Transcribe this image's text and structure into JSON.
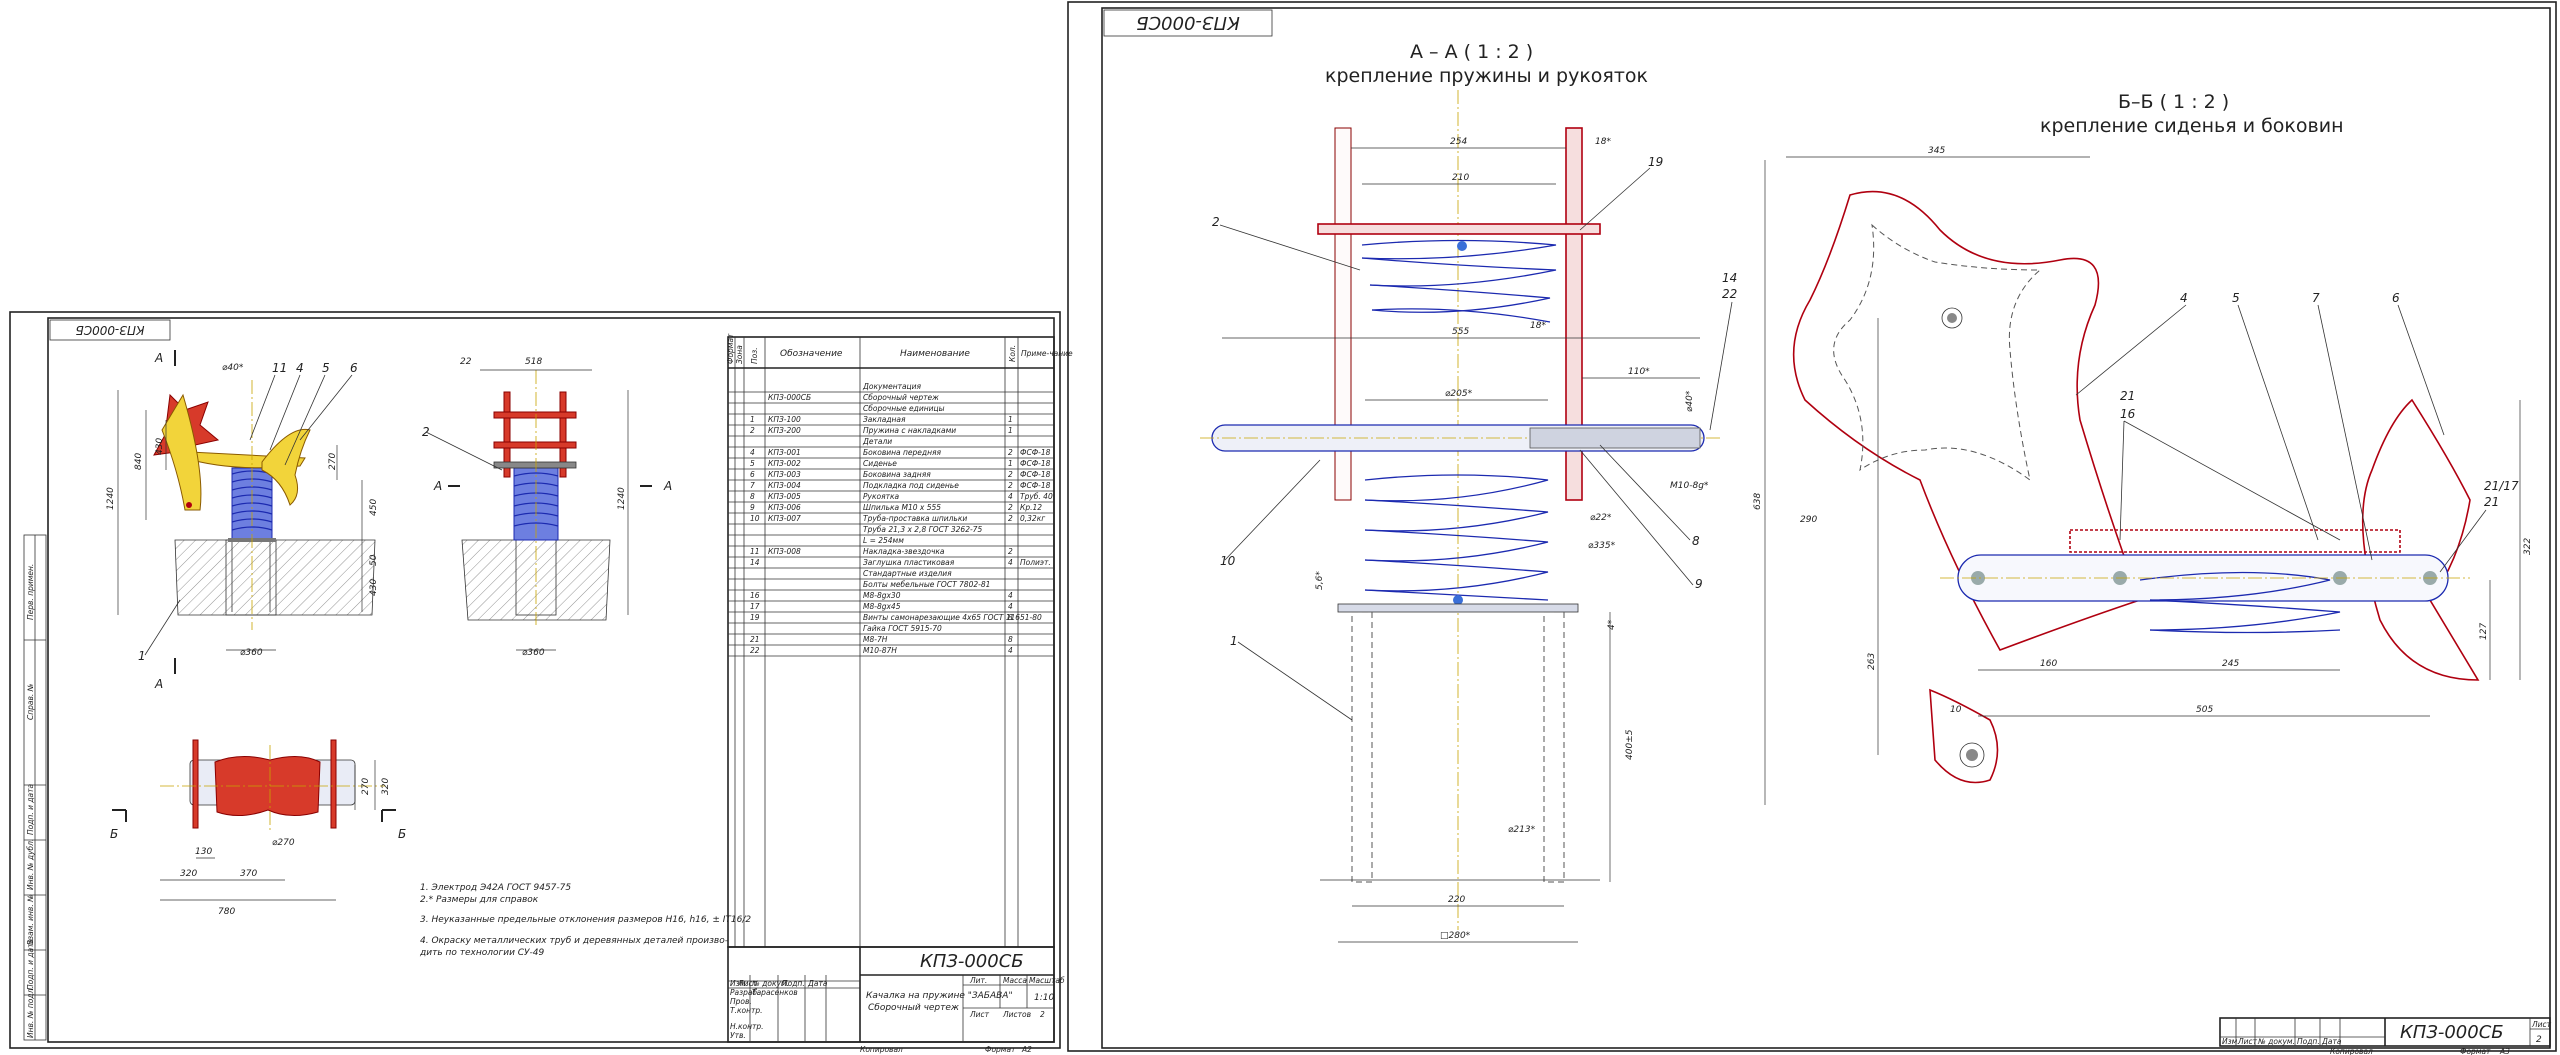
{
  "sheet1": {
    "stamp_rotated": "КПЗ-000СБ",
    "drawing_number": "КПЗ-000СБ",
    "product_name": "Качалка на пружине \"ЗАБАВА\"",
    "doc_type": "Сборочный чертеж",
    "scale": "1:10",
    "sheet_label": "Лист",
    "sheets_label": "Листов",
    "sheets_count": "2",
    "mass_label": "Масса",
    "scale_label": "Масштаб",
    "lit_label": "Лит.",
    "copied_label": "Копировал",
    "format_label": "Формат",
    "format_value": "А2",
    "section_a": "А",
    "section_b": "Б",
    "leaders": [
      "1",
      "2",
      "4",
      "5",
      "6",
      "11"
    ],
    "dims": [
      "⌀40*",
      "840",
      "430",
      "1240",
      "270",
      "450",
      "50",
      "430",
      "⌀360",
      "22",
      "518",
      "1240",
      "⌀360",
      "270",
      "320",
      "⌀270",
      "130",
      "320",
      "370",
      "780"
    ],
    "notes": [
      "1. Электрод Э42А ГОСТ 9457-75",
      "2.* Размеры для справок",
      "3. Неуказанные предельные отклонения размеров H16, h16, ± IT16/2",
      "4. Окраску металлических труб и деревянных деталей произво-",
      "дить по технологии СУ-49"
    ],
    "side_stamps": [
      "Перв. примен.",
      "Справ. №",
      "Подп. и дата",
      "Инв. № дубл.",
      "Взам. инв. №",
      "Подп. и дата",
      "Инв. № подл."
    ],
    "title_block_roles": [
      "Изм.",
      "Лист",
      "№ докум.",
      "Подп.",
      "Дата",
      "Разраб.",
      "Пров.",
      "Т.контр.",
      "Н.контр.",
      "Утв."
    ],
    "developer": "Тарасенков",
    "spec": {
      "headers": [
        "Формат",
        "Зона",
        "Поз.",
        "Обозначение",
        "Наименование",
        "Кол.",
        "Приме-чание"
      ],
      "rows": [
        {
          "pos": "",
          "code": "",
          "name": "Документация",
          "qty": "",
          "note": ""
        },
        {
          "pos": "",
          "code": "КПЗ-000СБ",
          "name": "Сборочный чертеж",
          "qty": "",
          "note": ""
        },
        {
          "pos": "",
          "code": "",
          "name": "Сборочные единицы",
          "qty": "",
          "note": ""
        },
        {
          "pos": "1",
          "code": "КПЗ-100",
          "name": "Закладная",
          "qty": "1",
          "note": ""
        },
        {
          "pos": "2",
          "code": "КПЗ-200",
          "name": "Пружина с накладками",
          "qty": "1",
          "note": ""
        },
        {
          "pos": "",
          "code": "",
          "name": "Детали",
          "qty": "",
          "note": ""
        },
        {
          "pos": "4",
          "code": "КПЗ-001",
          "name": "Боковина передняя",
          "qty": "2",
          "note": "ФСФ-18"
        },
        {
          "pos": "5",
          "code": "КПЗ-002",
          "name": "Сиденье",
          "qty": "1",
          "note": "ФСФ-18"
        },
        {
          "pos": "6",
          "code": "КПЗ-003",
          "name": "Боковина задняя",
          "qty": "2",
          "note": "ФСФ-18"
        },
        {
          "pos": "7",
          "code": "КПЗ-004",
          "name": "Подкладка под сиденье",
          "qty": "2",
          "note": "ФСФ-18"
        },
        {
          "pos": "8",
          "code": "КПЗ-005",
          "name": "Рукоятка",
          "qty": "4",
          "note": "Труб. 40"
        },
        {
          "pos": "9",
          "code": "КПЗ-006",
          "name": "Шпилька М10 х 555",
          "qty": "2",
          "note": "Кр.12"
        },
        {
          "pos": "10",
          "code": "КПЗ-007",
          "name": "Труба-проставка шпильки",
          "qty": "2",
          "note": "0,32кг"
        },
        {
          "pos": "",
          "code": "",
          "name": "Труба 21,3 х 2,8 ГОСТ 3262-75",
          "qty": "",
          "note": ""
        },
        {
          "pos": "",
          "code": "",
          "name": "L = 254мм",
          "qty": "",
          "note": ""
        },
        {
          "pos": "11",
          "code": "КПЗ-008",
          "name": "Накладка-звездочка",
          "qty": "2",
          "note": ""
        },
        {
          "pos": "14",
          "code": "",
          "name": "Заглушка пластиковая",
          "qty": "4",
          "note": "Полиэт."
        },
        {
          "pos": "",
          "code": "",
          "name": "Стандартные изделия",
          "qty": "",
          "note": ""
        },
        {
          "pos": "",
          "code": "",
          "name": "Болты мебельные ГОСТ 7802-81",
          "qty": "",
          "note": ""
        },
        {
          "pos": "16",
          "code": "",
          "name": "М8-8gх30",
          "qty": "4",
          "note": ""
        },
        {
          "pos": "17",
          "code": "",
          "name": "М8-8gх45",
          "qty": "4",
          "note": ""
        },
        {
          "pos": "19",
          "code": "",
          "name": "Винты самонарезающие 4х65 ГОСТ 11651-80",
          "qty": "8",
          "note": ""
        },
        {
          "pos": "",
          "code": "",
          "name": "Гайка ГОСТ 5915-70",
          "qty": "",
          "note": ""
        },
        {
          "pos": "21",
          "code": "",
          "name": "М8-7Н",
          "qty": "8",
          "note": ""
        },
        {
          "pos": "22",
          "code": "",
          "name": "М10-87Н",
          "qty": "4",
          "note": ""
        }
      ]
    }
  },
  "sheet2": {
    "stamp_rotated": "КПЗ-000СБ",
    "drawing_number": "КПЗ-000СБ",
    "sheet_label": "Лист",
    "sheet_number": "2",
    "copied_label": "Копировал",
    "format_label": "Формат",
    "format_value": "А3",
    "title_block_roles": [
      "Изм.",
      "Лист",
      "№ докум.",
      "Подп.",
      "Дата"
    ],
    "section_aa_title": "А – А ( 1 : 2 )",
    "section_aa_subtitle": "крепление пружины и рукояток",
    "section_bb_title": "Б–Б ( 1 : 2 )",
    "section_bb_subtitle": "крепление сиденья и боковин",
    "aa_leaders": [
      "2",
      "19",
      "14",
      "22",
      "10",
      "8",
      "9",
      "1"
    ],
    "aa_dims": [
      "254",
      "18*",
      "210",
      "18*",
      "555",
      "110*",
      "⌀205*",
      "⌀40*",
      "М10-8g*",
      "⌀22*",
      "⌀335*",
      "5,6*",
      "4*",
      "400±5",
      "⌀213*",
      "220",
      "□280*"
    ],
    "bb_leaders": [
      "4",
      "5",
      "7",
      "6",
      "21",
      "16",
      "21/17",
      "21"
    ],
    "bb_dims": [
      "345",
      "638",
      "290",
      "263",
      "160",
      "245",
      "505",
      "10",
      "127",
      "322"
    ]
  }
}
